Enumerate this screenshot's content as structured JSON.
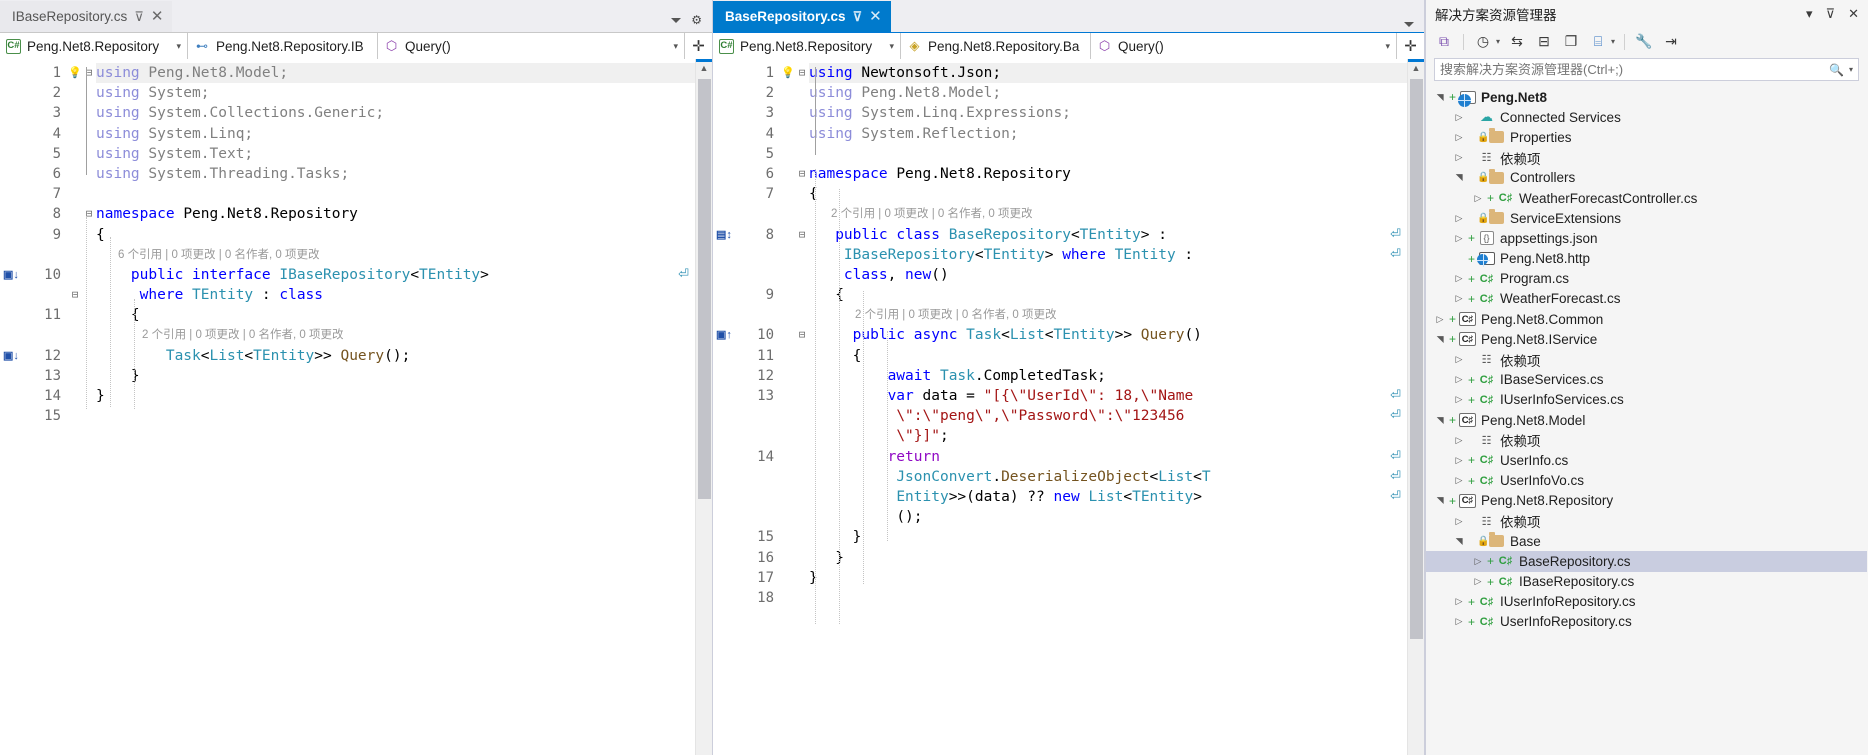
{
  "left_pane": {
    "tab": {
      "title": "IBaseRepository.cs",
      "pin": "pin-icon",
      "close": "close-icon",
      "state": "inactive"
    },
    "tab_tools": {
      "dropdown": "chevron-down-icon",
      "settings": "gear-icon"
    },
    "navbar": {
      "project": "Peng.Net8.Repository",
      "type": "Peng.Net8.Repository.IB",
      "member": "Query()",
      "project_icon": "csharp-project-icon",
      "type_icon": "interface-icon",
      "member_icon": "method-icon",
      "split_icon": "split-window-icon"
    },
    "code_lines": [
      {
        "n": "1",
        "bulb": true,
        "fold": "minus",
        "text": "using Peng.Net8.Model;",
        "style": "using-unused-highlight"
      },
      {
        "n": "2",
        "text": "using System;"
      },
      {
        "n": "3",
        "text": "using System.Collections.Generic;"
      },
      {
        "n": "4",
        "text": "using System.Linq;"
      },
      {
        "n": "5",
        "text": "using System.Text;"
      },
      {
        "n": "6",
        "text": "using System.Threading.Tasks;"
      },
      {
        "n": "7",
        "text": ""
      },
      {
        "n": "8",
        "fold": "minus",
        "text": "namespace Peng.Net8.Repository"
      },
      {
        "n": "9",
        "text": "{"
      },
      {
        "n": "10",
        "codelens": "6 个引用 | 0 项更改 | 0 名作者, 0 项更改",
        "marker": "I↓",
        "text": "public interface IBaseRepository<TEntity>"
      },
      {
        "n": "",
        "fold": "minus",
        "text": "where TEntity : class"
      },
      {
        "n": "11",
        "text": "{"
      },
      {
        "n": "12",
        "codelens": "2 个引用 | 0 项更改 | 0 名作者, 0 项更改",
        "marker": "I↓",
        "text": "Task<List<TEntity>> Query();"
      },
      {
        "n": "13",
        "text": "}"
      },
      {
        "n": "14",
        "text": "}"
      },
      {
        "n": "15",
        "text": ""
      }
    ]
  },
  "right_pane": {
    "tab": {
      "title": "BaseRepository.cs",
      "pin": "pin-icon",
      "close": "close-icon",
      "state": "active"
    },
    "tab_tools": {
      "dropdown": "chevron-down-icon"
    },
    "navbar": {
      "project": "Peng.Net8.Repository",
      "type": "Peng.Net8.Repository.Ba",
      "member": "Query()",
      "project_icon": "csharp-project-icon",
      "type_icon": "class-icon",
      "member_icon": "method-icon",
      "split_icon": "split-window-icon"
    },
    "code_lines": [
      {
        "n": "1",
        "bulb": true,
        "fold": "minus",
        "text": "using Newtonsoft.Json;",
        "active": true
      },
      {
        "n": "2",
        "text": "using Peng.Net8.Model;"
      },
      {
        "n": "3",
        "text": "using System.Linq.Expressions;"
      },
      {
        "n": "4",
        "text": "using System.Reflection;"
      },
      {
        "n": "5",
        "text": ""
      },
      {
        "n": "6",
        "fold": "minus",
        "text": "namespace Peng.Net8.Repository"
      },
      {
        "n": "7",
        "text": "{"
      },
      {
        "n": "8",
        "codelens": "2 个引用 | 0 项更改 | 0 名作者, 0 项更改",
        "marker": "I↕",
        "fold": "minus",
        "text": "public class BaseRepository<TEntity> : IBaseRepository<TEntity> where TEntity : class, new()"
      },
      {
        "n": "9",
        "text": "{"
      },
      {
        "n": "10",
        "codelens": "2 个引用 | 0 项更改 | 0 名作者, 0 项更改",
        "marker": "I↑",
        "fold": "minus",
        "text": "public async Task<List<TEntity>> Query()"
      },
      {
        "n": "11",
        "text": "{"
      },
      {
        "n": "12",
        "text": "await Task.CompletedTask;"
      },
      {
        "n": "13",
        "text": "var data = \"[{\\\"UserId\\\": 18,\\\"Name\\\":\\\"peng\\\",\\\"Password\\\":\\\"123456\\\"}]\";"
      },
      {
        "n": "14",
        "text": "return JsonConvert.DeserializeObject<List<TEntity>>(data) ?? new List<TEntity>();"
      },
      {
        "n": "15",
        "text": "}"
      },
      {
        "n": "16",
        "text": "}"
      },
      {
        "n": "17",
        "text": "}"
      },
      {
        "n": "18",
        "text": ""
      }
    ]
  },
  "solution_explorer": {
    "title": "解决方案资源管理器",
    "header_icons": {
      "dropdown": "chevron-down-icon",
      "pin": "pin-icon",
      "close": "close-icon"
    },
    "toolbar": [
      {
        "name": "code-map-icon",
        "glyph": "⧉"
      },
      {
        "name": "pending-changes-icon",
        "glyph": "◷"
      },
      {
        "name": "sync-with-active-document-icon",
        "glyph": "⇆"
      },
      {
        "name": "collapse-all-icon",
        "glyph": "⊟"
      },
      {
        "name": "show-all-files-icon",
        "glyph": "❐"
      },
      {
        "name": "solution-views-icon",
        "glyph": "⌸"
      },
      {
        "name": "properties-icon",
        "glyph": "🔧"
      },
      {
        "name": "preview-selected-items-icon",
        "glyph": "⇥"
      }
    ],
    "search_placeholder": "搜索解决方案资源管理器(Ctrl+;)",
    "search_value": "",
    "search_icon": "search-icon",
    "tree": [
      {
        "label": "Peng.Net8",
        "indent": 0,
        "expander": "expanded",
        "plus": true,
        "icon": "project-web-icon",
        "bold": true
      },
      {
        "label": "Connected Services",
        "indent": 1,
        "expander": "collapsed",
        "plus": false,
        "icon": "connected-services-icon"
      },
      {
        "label": "Properties",
        "indent": 1,
        "expander": "collapsed",
        "plus": false,
        "icon": "properties-folder-icon",
        "lock": true
      },
      {
        "label": "依赖项",
        "indent": 1,
        "expander": "collapsed",
        "plus": false,
        "icon": "dependencies-icon"
      },
      {
        "label": "Controllers",
        "indent": 1,
        "expander": "expanded",
        "plus": false,
        "icon": "folder-icon",
        "lock": true
      },
      {
        "label": "WeatherForecastController.cs",
        "indent": 2,
        "expander": "collapsed",
        "plus": true,
        "icon": "csharp-file-icon"
      },
      {
        "label": "ServiceExtensions",
        "indent": 1,
        "expander": "collapsed",
        "plus": false,
        "icon": "folder-icon",
        "lock": true
      },
      {
        "label": "appsettings.json",
        "indent": 1,
        "expander": "collapsed",
        "plus": true,
        "icon": "json-file-icon"
      },
      {
        "label": "Peng.Net8.http",
        "indent": 1,
        "expander": "none",
        "plus": true,
        "icon": "http-file-icon"
      },
      {
        "label": "Program.cs",
        "indent": 1,
        "expander": "collapsed",
        "plus": true,
        "icon": "csharp-file-icon"
      },
      {
        "label": "WeatherForecast.cs",
        "indent": 1,
        "expander": "collapsed",
        "plus": true,
        "icon": "csharp-file-icon"
      },
      {
        "label": "Peng.Net8.Common",
        "indent": 0,
        "expander": "collapsed",
        "plus": true,
        "icon": "csharp-project-icon"
      },
      {
        "label": "Peng.Net8.IService",
        "indent": 0,
        "expander": "expanded",
        "plus": true,
        "icon": "csharp-project-icon"
      },
      {
        "label": "依赖项",
        "indent": 1,
        "expander": "collapsed",
        "plus": false,
        "icon": "dependencies-icon"
      },
      {
        "label": "IBaseServices.cs",
        "indent": 1,
        "expander": "collapsed",
        "plus": true,
        "icon": "csharp-file-icon"
      },
      {
        "label": "IUserInfoServices.cs",
        "indent": 1,
        "expander": "collapsed",
        "plus": true,
        "icon": "csharp-file-icon"
      },
      {
        "label": "Peng.Net8.Model",
        "indent": 0,
        "expander": "expanded",
        "plus": true,
        "icon": "csharp-project-icon"
      },
      {
        "label": "依赖项",
        "indent": 1,
        "expander": "collapsed",
        "plus": false,
        "icon": "dependencies-icon"
      },
      {
        "label": "UserInfo.cs",
        "indent": 1,
        "expander": "collapsed",
        "plus": true,
        "icon": "csharp-file-icon"
      },
      {
        "label": "UserInfoVo.cs",
        "indent": 1,
        "expander": "collapsed",
        "plus": true,
        "icon": "csharp-file-icon"
      },
      {
        "label": "Peng.Net8.Repository",
        "indent": 0,
        "expander": "expanded",
        "plus": true,
        "icon": "csharp-project-icon"
      },
      {
        "label": "依赖项",
        "indent": 1,
        "expander": "collapsed",
        "plus": false,
        "icon": "dependencies-icon"
      },
      {
        "label": "Base",
        "indent": 1,
        "expander": "expanded",
        "plus": false,
        "icon": "folder-icon",
        "lock": true
      },
      {
        "label": "BaseRepository.cs",
        "indent": 2,
        "expander": "collapsed",
        "plus": true,
        "icon": "csharp-file-icon",
        "selected": true
      },
      {
        "label": "IBaseRepository.cs",
        "indent": 2,
        "expander": "collapsed",
        "plus": true,
        "icon": "csharp-file-icon"
      },
      {
        "label": "IUserInfoRepository.cs",
        "indent": 1,
        "expander": "collapsed",
        "plus": true,
        "icon": "csharp-file-icon"
      },
      {
        "label": "UserInfoRepository.cs",
        "indent": 1,
        "expander": "collapsed",
        "plus": true,
        "icon": "csharp-file-icon"
      }
    ]
  },
  "colors": {
    "active_tab": "#007acc",
    "selection": "#c9cde0",
    "keyword": "#0000ff",
    "type": "#2b91af",
    "string": "#a31515",
    "codelens": "#9a9a9a"
  }
}
